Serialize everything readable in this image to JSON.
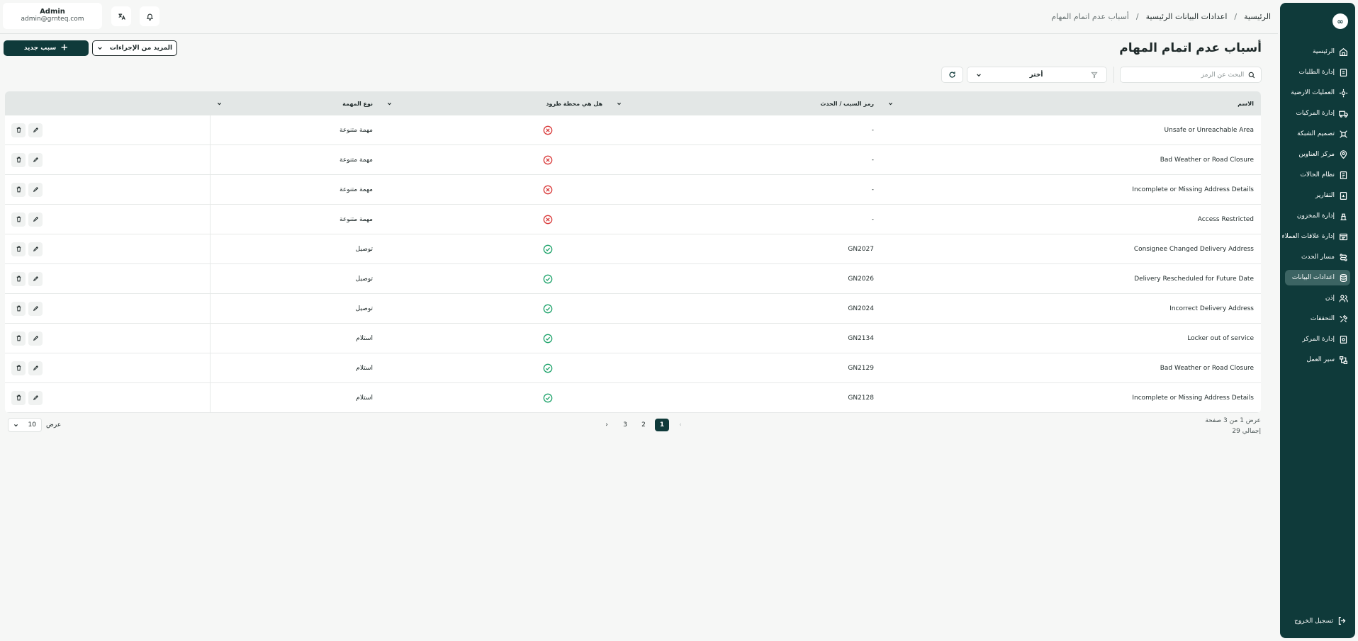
{
  "header": {
    "breadcrumb": [
      "الرئيسية",
      "اعدادات البيانات الرئيسية",
      "أسباب عدم اتمام المهام"
    ],
    "user": {
      "name": "Admin",
      "email": "admin@grnteq.com"
    }
  },
  "sidebar": {
    "logo": "∞",
    "items": [
      {
        "label": "الرئيسية",
        "icon": "home-icon"
      },
      {
        "label": "إدارة الطلبات",
        "icon": "orders-icon"
      },
      {
        "label": "العمليات الارضية",
        "icon": "ground-ops-icon"
      },
      {
        "label": "إدارة المركبات",
        "icon": "truck-icon"
      },
      {
        "label": "تصميم الشبكة",
        "icon": "network-icon"
      },
      {
        "label": "مركز العناوين",
        "icon": "address-icon"
      },
      {
        "label": "نظام الحالات",
        "icon": "status-icon"
      },
      {
        "label": "التقارير",
        "icon": "reports-icon"
      },
      {
        "label": "إدارة المخزون",
        "icon": "inventory-icon"
      },
      {
        "label": "إدارة علاقات العملاء",
        "icon": "crm-icon"
      },
      {
        "label": "مسار الحدث",
        "icon": "route-icon"
      },
      {
        "label": "اعدادات البيانات",
        "icon": "database-icon",
        "active": true
      },
      {
        "label": "إذن",
        "icon": "users-icon"
      },
      {
        "label": "التحققات",
        "icon": "tools-icon"
      },
      {
        "label": "إدارة المركز",
        "icon": "hub-icon"
      },
      {
        "label": "سير العمل",
        "icon": "workflow-icon"
      }
    ],
    "logout": "تسجيل الخروج"
  },
  "page": {
    "title": "أسباب عدم اتمام المهام",
    "new_button": "سبب جديد",
    "more_actions": "المزيد من الإجراءات"
  },
  "toolbar": {
    "search_placeholder": "البحث عن الرمز",
    "filter_value": "أختر"
  },
  "table": {
    "columns": [
      "الاسم",
      "رمز السبب / الحدث",
      "هل هي محطة طرود",
      "نوع المهمة"
    ],
    "rows": [
      {
        "name": "Unsafe or Unreachable Area",
        "code": "-",
        "station": false,
        "type": "مهمة متنوعة"
      },
      {
        "name": "Bad Weather or Road Closure",
        "code": "-",
        "station": false,
        "type": "مهمة متنوعة"
      },
      {
        "name": "Incomplete or Missing Address Details",
        "code": "-",
        "station": false,
        "type": "مهمة متنوعة"
      },
      {
        "name": "Access Restricted",
        "code": "-",
        "station": false,
        "type": "مهمة متنوعة"
      },
      {
        "name": "Consignee Changed Delivery Address",
        "code": "GN2027",
        "station": true,
        "type": "توصيل"
      },
      {
        "name": "Delivery Rescheduled for Future Date",
        "code": "GN2026",
        "station": true,
        "type": "توصيل"
      },
      {
        "name": "Incorrect Delivery Address",
        "code": "GN2024",
        "station": true,
        "type": "توصيل"
      },
      {
        "name": "Locker out of service",
        "code": "GN2134",
        "station": true,
        "type": "استلام"
      },
      {
        "name": "Bad Weather or Road Closure",
        "code": "GN2129",
        "station": true,
        "type": "استلام"
      },
      {
        "name": "Incomplete or Missing Address Details",
        "code": "GN2128",
        "station": true,
        "type": "استلام"
      }
    ]
  },
  "pagination": {
    "info": "عرض 1 من 3 صفحة",
    "total": "إجمالي 29",
    "pages": [
      "1",
      "2",
      "3"
    ],
    "current": "1",
    "rows_label": "عرض",
    "rows_value": "10"
  },
  "colors": {
    "primary": "#0f3a3a",
    "success": "#1fa36b",
    "danger": "#d93a3a"
  }
}
